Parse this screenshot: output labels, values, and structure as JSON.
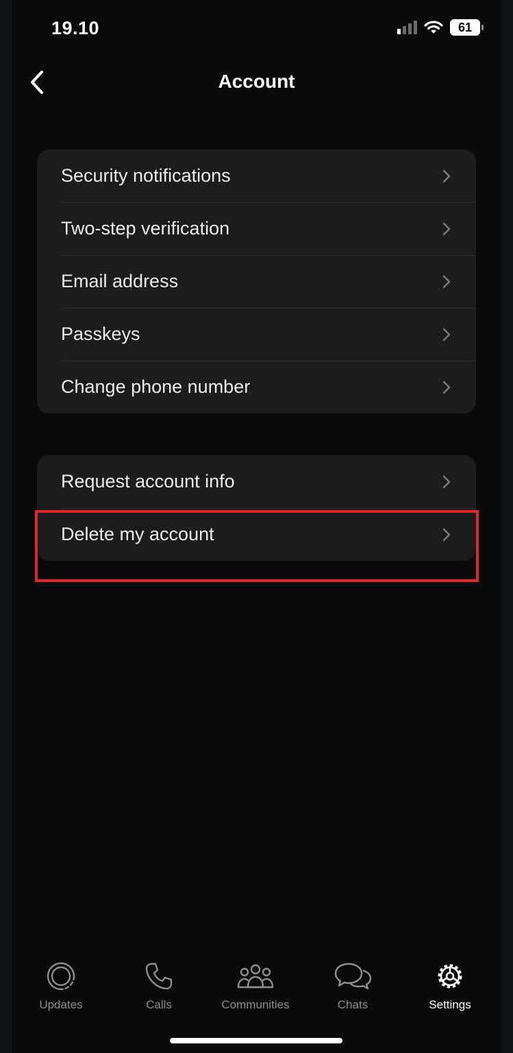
{
  "status_bar": {
    "time": "19.10",
    "battery": "61"
  },
  "header": {
    "title": "Account"
  },
  "groups": [
    {
      "items": [
        {
          "label": "Security notifications"
        },
        {
          "label": "Two-step verification"
        },
        {
          "label": "Email address"
        },
        {
          "label": "Passkeys"
        },
        {
          "label": "Change phone number"
        }
      ]
    },
    {
      "items": [
        {
          "label": "Request account info"
        },
        {
          "label": "Delete my account",
          "highlighted": true
        }
      ]
    }
  ],
  "tabbar": {
    "tabs": [
      {
        "label": "Updates",
        "icon": "updates-icon"
      },
      {
        "label": "Calls",
        "icon": "phone-icon"
      },
      {
        "label": "Communities",
        "icon": "communities-icon"
      },
      {
        "label": "Chats",
        "icon": "chats-icon"
      },
      {
        "label": "Settings",
        "icon": "gear-icon",
        "active": true
      }
    ]
  },
  "colors": {
    "background": "#0a0a0a",
    "group_bg": "#1c1c1e",
    "highlight_border": "#e0282c",
    "inactive_tab": "#8e8e8e",
    "active_tab": "#ffffff"
  }
}
